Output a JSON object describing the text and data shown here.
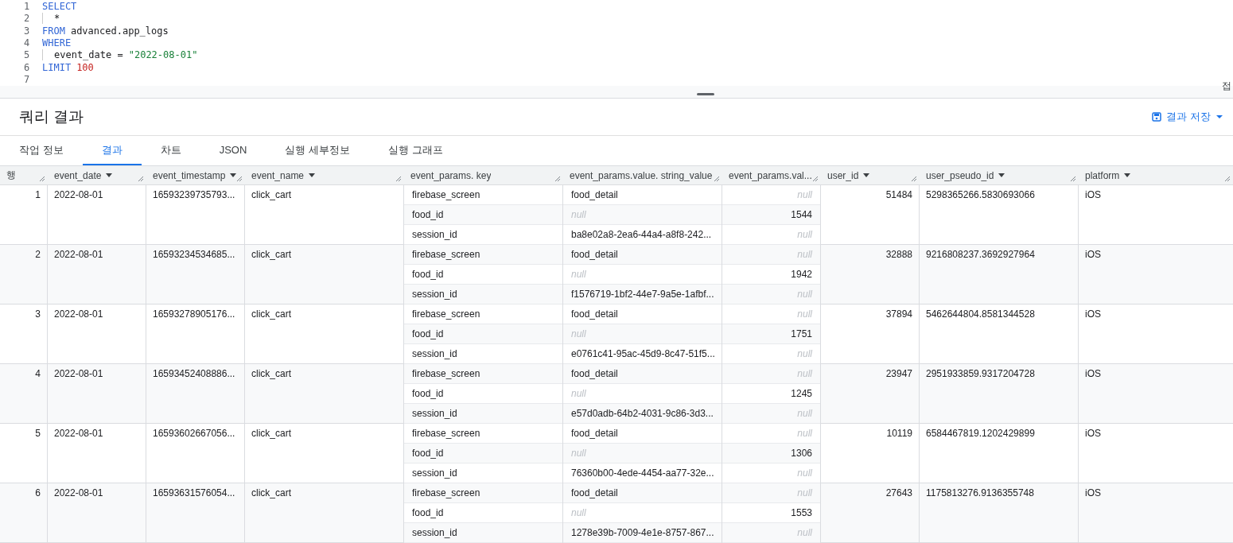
{
  "editor": {
    "lines": [
      {
        "number": "1",
        "indent": false,
        "tokens": [
          {
            "text": "SELECT",
            "kind": "keyword"
          }
        ]
      },
      {
        "number": "2",
        "indent": true,
        "tokens": [
          {
            "text": "*",
            "kind": "plain"
          }
        ]
      },
      {
        "number": "3",
        "indent": false,
        "tokens": [
          {
            "text": "FROM",
            "kind": "keyword"
          },
          {
            "text": "advanced.app_logs",
            "kind": "plain"
          }
        ]
      },
      {
        "number": "4",
        "indent": false,
        "tokens": [
          {
            "text": "WHERE",
            "kind": "keyword"
          }
        ]
      },
      {
        "number": "5",
        "indent": true,
        "tokens": [
          {
            "text": "event_date =",
            "kind": "plain"
          },
          {
            "text": "\"2022-08-01\"",
            "kind": "string"
          }
        ]
      },
      {
        "number": "6",
        "indent": false,
        "tokens": [
          {
            "text": "LIMIT",
            "kind": "keyword"
          },
          {
            "text": "100",
            "kind": "number"
          }
        ]
      },
      {
        "number": "7"
      }
    ],
    "side_label": "접"
  },
  "results": {
    "title": "쿼리 결과",
    "save_button": "결과 저장"
  },
  "tabs": [
    {
      "label": "작업 정보",
      "selected": false
    },
    {
      "label": "결과",
      "selected": true
    },
    {
      "label": "차트",
      "selected": false
    },
    {
      "label": "JSON",
      "selected": false
    },
    {
      "label": "실행 세부정보",
      "selected": false
    },
    {
      "label": "실행 그래프",
      "selected": false
    }
  ],
  "table": {
    "columns": [
      {
        "label": "행",
        "sortable": false
      },
      {
        "label": "event_date",
        "sortable": true
      },
      {
        "label": "event_timestamp",
        "sortable": true
      },
      {
        "label": "event_name",
        "sortable": true
      },
      {
        "label": "event_params. key",
        "sortable": false
      },
      {
        "label": "event_params.value. string_value",
        "sortable": false
      },
      {
        "label": "event_params.val...",
        "sortable": false
      },
      {
        "label": "user_id",
        "sortable": true
      },
      {
        "label": "user_pseudo_id",
        "sortable": true
      },
      {
        "label": "platform",
        "sortable": true
      }
    ],
    "rows": [
      {
        "index": "1",
        "event_date": "2022-08-01",
        "event_timestamp": "16593239735793...",
        "event_name": "click_cart",
        "params": [
          {
            "key": "firebase_screen",
            "string_value": {
              "text": "food_detail",
              "null": false
            },
            "int_value": {
              "text": "null",
              "null": true
            }
          },
          {
            "key": "food_id",
            "string_value": {
              "text": "null",
              "null": true
            },
            "int_value": {
              "text": "1544",
              "null": false
            }
          },
          {
            "key": "session_id",
            "string_value": {
              "text": "ba8e02a8-2ea6-44a4-a8f8-242...",
              "null": false
            },
            "int_value": {
              "text": "null",
              "null": true
            }
          }
        ],
        "user_id": "51484",
        "user_pseudo_id": "5298365266.5830693066",
        "platform": "iOS"
      },
      {
        "index": "2",
        "event_date": "2022-08-01",
        "event_timestamp": "16593234534685...",
        "event_name": "click_cart",
        "params": [
          {
            "key": "firebase_screen",
            "string_value": {
              "text": "food_detail",
              "null": false
            },
            "int_value": {
              "text": "null",
              "null": true
            }
          },
          {
            "key": "food_id",
            "string_value": {
              "text": "null",
              "null": true
            },
            "int_value": {
              "text": "1942",
              "null": false
            }
          },
          {
            "key": "session_id",
            "string_value": {
              "text": "f1576719-1bf2-44e7-9a5e-1afbf...",
              "null": false
            },
            "int_value": {
              "text": "null",
              "null": true
            }
          }
        ],
        "user_id": "32888",
        "user_pseudo_id": "9216808237.3692927964",
        "platform": "iOS"
      },
      {
        "index": "3",
        "event_date": "2022-08-01",
        "event_timestamp": "16593278905176...",
        "event_name": "click_cart",
        "params": [
          {
            "key": "firebase_screen",
            "string_value": {
              "text": "food_detail",
              "null": false
            },
            "int_value": {
              "text": "null",
              "null": true
            }
          },
          {
            "key": "food_id",
            "string_value": {
              "text": "null",
              "null": true
            },
            "int_value": {
              "text": "1751",
              "null": false
            }
          },
          {
            "key": "session_id",
            "string_value": {
              "text": "e0761c41-95ac-45d9-8c47-51f5...",
              "null": false
            },
            "int_value": {
              "text": "null",
              "null": true
            }
          }
        ],
        "user_id": "37894",
        "user_pseudo_id": "5462644804.8581344528",
        "platform": "iOS"
      },
      {
        "index": "4",
        "event_date": "2022-08-01",
        "event_timestamp": "16593452408886...",
        "event_name": "click_cart",
        "params": [
          {
            "key": "firebase_screen",
            "string_value": {
              "text": "food_detail",
              "null": false
            },
            "int_value": {
              "text": "null",
              "null": true
            }
          },
          {
            "key": "food_id",
            "string_value": {
              "text": "null",
              "null": true
            },
            "int_value": {
              "text": "1245",
              "null": false
            }
          },
          {
            "key": "session_id",
            "string_value": {
              "text": "e57d0adb-64b2-4031-9c86-3d3...",
              "null": false
            },
            "int_value": {
              "text": "null",
              "null": true
            }
          }
        ],
        "user_id": "23947",
        "user_pseudo_id": "2951933859.9317204728",
        "platform": "iOS"
      },
      {
        "index": "5",
        "event_date": "2022-08-01",
        "event_timestamp": "16593602667056...",
        "event_name": "click_cart",
        "params": [
          {
            "key": "firebase_screen",
            "string_value": {
              "text": "food_detail",
              "null": false
            },
            "int_value": {
              "text": "null",
              "null": true
            }
          },
          {
            "key": "food_id",
            "string_value": {
              "text": "null",
              "null": true
            },
            "int_value": {
              "text": "1306",
              "null": false
            }
          },
          {
            "key": "session_id",
            "string_value": {
              "text": "76360b00-4ede-4454-aa77-32e...",
              "null": false
            },
            "int_value": {
              "text": "null",
              "null": true
            }
          }
        ],
        "user_id": "10119",
        "user_pseudo_id": "6584467819.1202429899",
        "platform": "iOS"
      },
      {
        "index": "6",
        "event_date": "2022-08-01",
        "event_timestamp": "16593631576054...",
        "event_name": "click_cart",
        "params": [
          {
            "key": "firebase_screen",
            "string_value": {
              "text": "food_detail",
              "null": false
            },
            "int_value": {
              "text": "null",
              "null": true
            }
          },
          {
            "key": "food_id",
            "string_value": {
              "text": "null",
              "null": true
            },
            "int_value": {
              "text": "1553",
              "null": false
            }
          },
          {
            "key": "session_id",
            "string_value": {
              "text": "1278e39b-7009-4e1e-8757-867...",
              "null": false
            },
            "int_value": {
              "text": "null",
              "null": true
            }
          }
        ],
        "user_id": "27643",
        "user_pseudo_id": "1175813276.9136355748",
        "platform": "iOS"
      }
    ]
  }
}
